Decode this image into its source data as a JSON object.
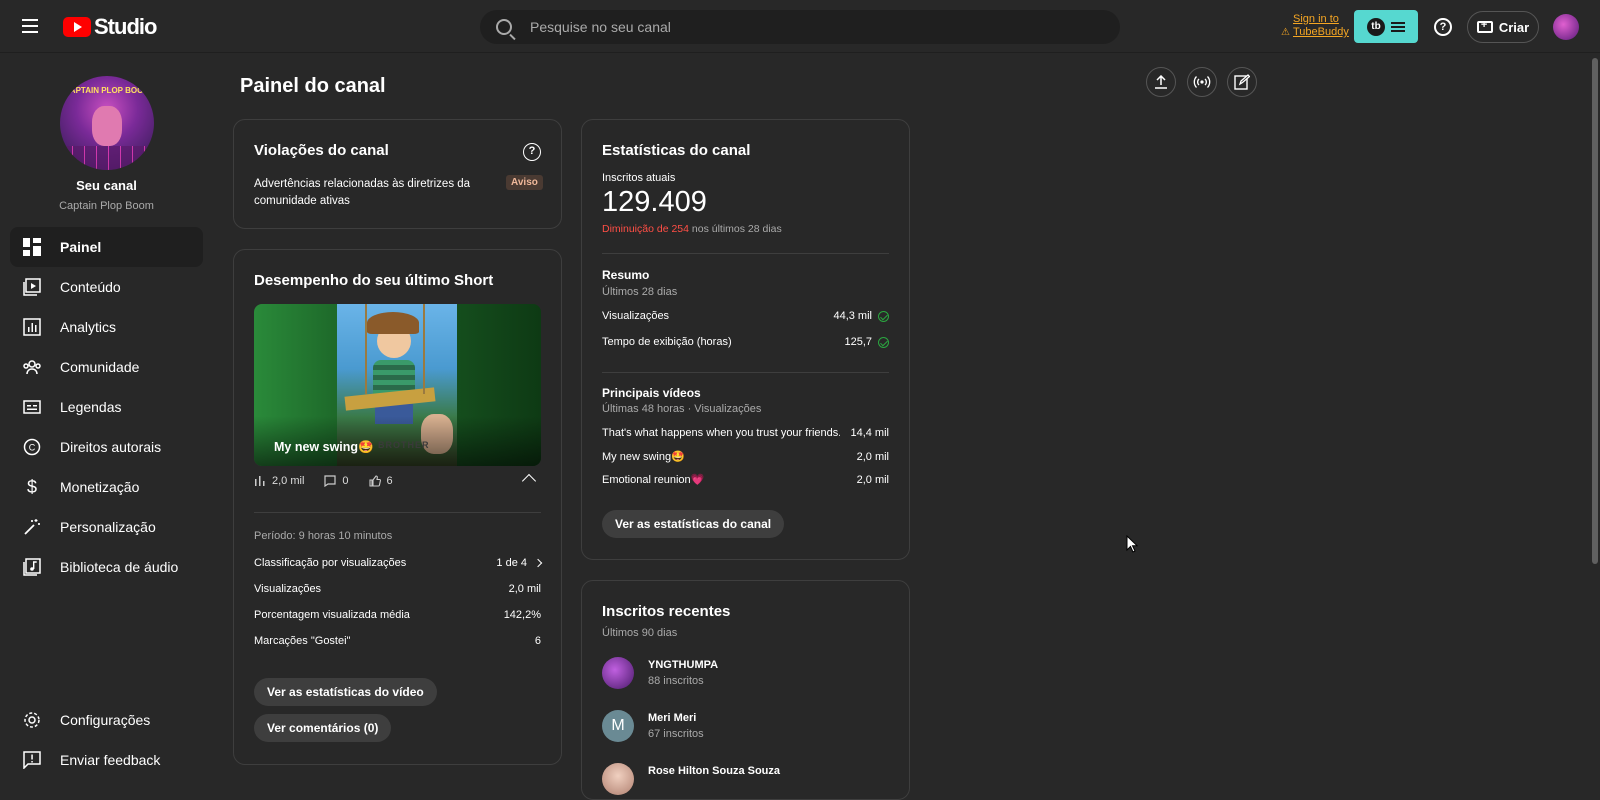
{
  "header": {
    "studio_label": "Studio",
    "search_placeholder": "Pesquise no seu canal",
    "tubebuddy_signin_line1": "Sign in to",
    "tubebuddy_signin_line2": "TubeBuddy",
    "tubebuddy_badge": "tb",
    "create_label": "Criar"
  },
  "sidebar": {
    "channel_title": "Seu canal",
    "channel_name": "Captain Plop Boom",
    "avatar_text": "CAPTAIN PLOP BOOM",
    "items": [
      {
        "label": "Painel",
        "icon": "dashboard-icon"
      },
      {
        "label": "Conteúdo",
        "icon": "content-icon"
      },
      {
        "label": "Analytics",
        "icon": "analytics-icon"
      },
      {
        "label": "Comunidade",
        "icon": "community-icon"
      },
      {
        "label": "Legendas",
        "icon": "subtitles-icon"
      },
      {
        "label": "Direitos autorais",
        "icon": "copyright-icon"
      },
      {
        "label": "Monetização",
        "icon": "dollar-icon"
      },
      {
        "label": "Personalização",
        "icon": "magic-wand-icon"
      },
      {
        "label": "Biblioteca de áudio",
        "icon": "audio-library-icon"
      }
    ],
    "footer": [
      {
        "label": "Configurações",
        "icon": "gear-icon"
      },
      {
        "label": "Enviar feedback",
        "icon": "feedback-icon"
      }
    ]
  },
  "main": {
    "page_title": "Painel do canal"
  },
  "violations": {
    "title": "Violações do canal",
    "text": "Advertências relacionadas às diretrizes da comunidade ativas",
    "badge": "Aviso"
  },
  "short": {
    "title": "Desempenho do seu último Short",
    "video_title": "My new swing🤩",
    "thumb_watermark": "BROTHER",
    "views": "2,0 mil",
    "comments": "0",
    "likes": "6",
    "period": "Período: 9 horas 10 minutos",
    "stats": [
      {
        "label": "Classificação por visualizações",
        "value": "1 de 4"
      },
      {
        "label": "Visualizações",
        "value": "2,0 mil"
      },
      {
        "label": "Porcentagem visualizada média",
        "value": "142,2%"
      },
      {
        "label": "Marcações \"Gostei\"",
        "value": "6"
      }
    ],
    "btn_video_stats": "Ver as estatísticas do vídeo",
    "btn_comments": "Ver comentários (0)"
  },
  "channel_stats": {
    "title": "Estatísticas do canal",
    "subs_label": "Inscritos atuais",
    "subs_value": "129.409",
    "change_red": "Diminuição de 254",
    "change_rest": " nos últimos 28 dias",
    "summary_title": "Resumo",
    "summary_period": "Últimos 28 dias",
    "summary": [
      {
        "label": "Visualizações",
        "value": "44,3 mil"
      },
      {
        "label": "Tempo de exibição (horas)",
        "value": "125,7"
      }
    ],
    "top_title": "Principais vídeos",
    "top_period": "Últimas 48 horas · Visualizações",
    "top_videos": [
      {
        "label": "That's what happens when you trust your friends...",
        "value": "14,4 mil"
      },
      {
        "label": "My new swing🤩",
        "value": "2,0 mil"
      },
      {
        "label": "Emotional reunion💗",
        "value": "2,0 mil"
      }
    ],
    "btn": "Ver as estatísticas do canal"
  },
  "recent_subs": {
    "title": "Inscritos recentes",
    "period": "Últimos 90 dias",
    "items": [
      {
        "name": "YNGTHUMPA",
        "count": "88 inscritos",
        "initial": ""
      },
      {
        "name": "Meri Meri",
        "count": "67 inscritos",
        "initial": "M"
      },
      {
        "name": "Rose Hilton Souza Souza",
        "count": "",
        "initial": ""
      }
    ]
  },
  "colors": {
    "accent_red": "#ff4e45",
    "tubebuddy_teal": "#56d8d0",
    "check_green": "#2ba640"
  }
}
